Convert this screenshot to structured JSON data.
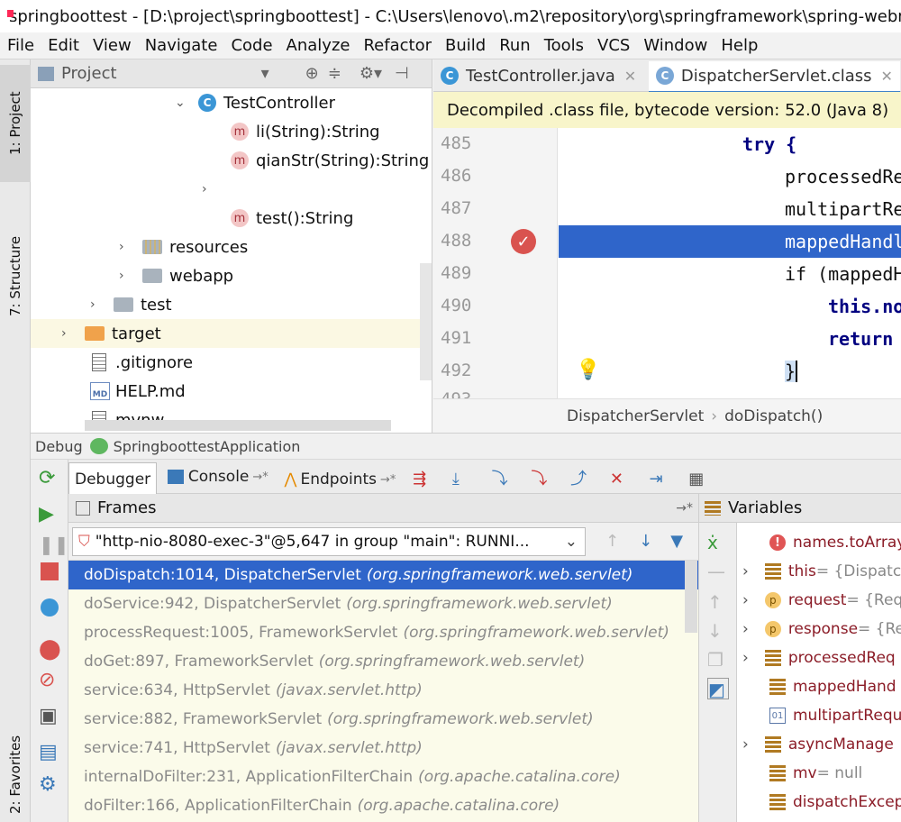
{
  "window": {
    "title": "springboottest - [D:\\project\\springboottest] - C:\\Users\\lenovo\\.m2\\repository\\org\\springframework\\spring-webm"
  },
  "menu": [
    "File",
    "Edit",
    "View",
    "Navigate",
    "Code",
    "Analyze",
    "Refactor",
    "Build",
    "Run",
    "Tools",
    "VCS",
    "Window",
    "Help"
  ],
  "left_strip": {
    "project_tab": "1: Project",
    "structure_tab": "7: Structure",
    "favorites_tab": "2: Favorites"
  },
  "project": {
    "header": "Project",
    "tree": [
      {
        "label": "TestController",
        "kind": "class",
        "expanded": true
      },
      {
        "label": "li(String):String",
        "kind": "method"
      },
      {
        "label": "qianStr(String):String",
        "kind": "method"
      },
      {
        "label": "",
        "kind": "collapsed"
      },
      {
        "label": "test():String",
        "kind": "method"
      },
      {
        "label": "resources",
        "kind": "folder"
      },
      {
        "label": "webapp",
        "kind": "folder"
      },
      {
        "label": "test",
        "kind": "folder"
      },
      {
        "label": "target",
        "kind": "folder-excluded"
      },
      {
        "label": ".gitignore",
        "kind": "file"
      },
      {
        "label": "HELP.md",
        "kind": "md"
      },
      {
        "label": "mvnw",
        "kind": "file"
      }
    ]
  },
  "editor": {
    "tabs": [
      {
        "label": "TestController.java",
        "active": false
      },
      {
        "label": "DispatcherServlet.class",
        "active": true
      }
    ],
    "banner": "Decompiled .class file, bytecode version: 52.0 (Java 8)",
    "lines": [
      {
        "no": "485",
        "text": "try {"
      },
      {
        "no": "486",
        "text": "processedRe"
      },
      {
        "no": "487",
        "text": "multipartRe"
      },
      {
        "no": "488",
        "text": "mappedHandl"
      },
      {
        "no": "489",
        "text": "if (mappedH"
      },
      {
        "no": "490",
        "text": "this.no"
      },
      {
        "no": "491",
        "text": "return"
      },
      {
        "no": "492",
        "text": "}"
      },
      {
        "no": "493",
        "text": ""
      }
    ],
    "breadcrumb": [
      "DispatcherServlet",
      "doDispatch()"
    ]
  },
  "debug": {
    "label": "Debug",
    "config": "SpringboottestApplication",
    "tabs": [
      {
        "label": "Debugger",
        "active": true
      },
      {
        "label": "Console",
        "active": false
      },
      {
        "label": "Endpoints",
        "active": false
      }
    ],
    "frames_title": "Frames",
    "thread": "\"http-nio-8080-exec-3\"@5,647 in group \"main\": RUNNI...",
    "frames": [
      {
        "method": "doDispatch:1014, DispatcherServlet",
        "pkg": "(org.springframework.web.servlet)"
      },
      {
        "method": "doService:942, DispatcherServlet",
        "pkg": "(org.springframework.web.servlet)"
      },
      {
        "method": "processRequest:1005, FrameworkServlet",
        "pkg": "(org.springframework.web.servlet)"
      },
      {
        "method": "doGet:897, FrameworkServlet",
        "pkg": "(org.springframework.web.servlet)"
      },
      {
        "method": "service:634, HttpServlet",
        "pkg": "(javax.servlet.http)"
      },
      {
        "method": "service:882, FrameworkServlet",
        "pkg": "(org.springframework.web.servlet)"
      },
      {
        "method": "service:741, HttpServlet",
        "pkg": "(javax.servlet.http)"
      },
      {
        "method": "internalDoFilter:231, ApplicationFilterChain",
        "pkg": "(org.apache.catalina.core)"
      },
      {
        "method": "doFilter:166, ApplicationFilterChain",
        "pkg": "(org.apache.catalina.core)"
      }
    ],
    "variables_title": "Variables",
    "variables": [
      {
        "name": "names.toArray",
        "value": "",
        "icon": "err"
      },
      {
        "name": "this",
        "value": " = {Dispatc",
        "icon": "stack",
        "expandable": true
      },
      {
        "name": "request",
        "value": " = {Req",
        "icon": "p",
        "expandable": true
      },
      {
        "name": "response",
        "value": " = {Re",
        "icon": "p",
        "expandable": true
      },
      {
        "name": "processedReq",
        "value": "",
        "icon": "stack",
        "expandable": true
      },
      {
        "name": "mappedHand",
        "value": "",
        "icon": "stack"
      },
      {
        "name": "multipartRequ",
        "value": "",
        "icon": "num"
      },
      {
        "name": "asyncManage",
        "value": "",
        "icon": "stack",
        "expandable": true
      },
      {
        "name": "mv",
        "value": " = null",
        "icon": "stack"
      },
      {
        "name": "dispatchExcep",
        "value": "",
        "icon": "stack"
      }
    ]
  }
}
